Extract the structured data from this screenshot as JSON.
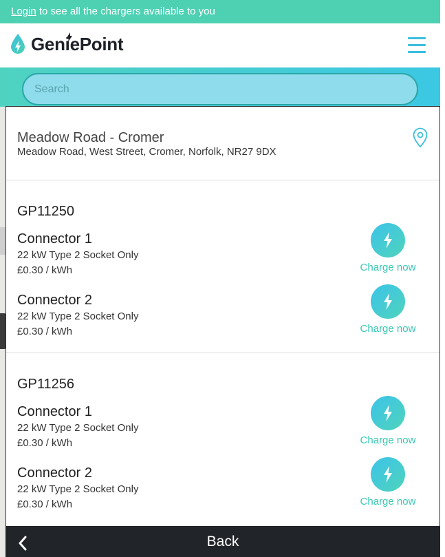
{
  "banner": {
    "login_link": "Login",
    "message": " to see all the chargers available to you"
  },
  "header": {
    "brand": "GeniePoint",
    "menu_icon": "hamburger-menu-icon"
  },
  "search": {
    "placeholder": "Search"
  },
  "site": {
    "name": "Meadow Road - Cromer",
    "address": "Meadow Road, West Street, Cromer, Norfolk, NR27 9DX",
    "icon": "map-pin-icon"
  },
  "groups": [
    {
      "id": "GP11250",
      "connectors": [
        {
          "title": "Connector 1",
          "spec": "22 kW Type 2 Socket Only",
          "price": "£0.30 / kWh",
          "action": "Charge now"
        },
        {
          "title": "Connector 2",
          "spec": "22 kW Type 2 Socket Only",
          "price": "£0.30 / kWh",
          "action": "Charge now"
        }
      ]
    },
    {
      "id": "GP11256",
      "connectors": [
        {
          "title": "Connector 1",
          "spec": "22 kW Type 2 Socket Only",
          "price": "£0.30 / kWh",
          "action": "Charge now"
        },
        {
          "title": "Connector 2",
          "spec": "22 kW Type 2 Socket Only",
          "price": "£0.30 / kWh",
          "action": "Charge now"
        }
      ]
    }
  ],
  "footer": {
    "back_label": "Back",
    "back_icon": "chevron-left-icon"
  },
  "colors": {
    "brand_green": "#4dd1b2",
    "brand_blue": "#3bbfe0",
    "dark": "#212428"
  }
}
